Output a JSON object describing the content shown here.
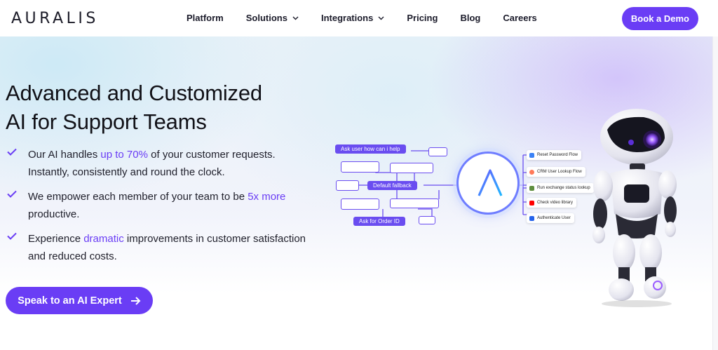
{
  "header": {
    "logo": "AURALIS",
    "nav": [
      {
        "label": "Platform",
        "dropdown": false
      },
      {
        "label": "Solutions",
        "dropdown": true
      },
      {
        "label": "Integrations",
        "dropdown": true
      },
      {
        "label": "Pricing",
        "dropdown": false
      },
      {
        "label": "Blog",
        "dropdown": false
      },
      {
        "label": "Careers",
        "dropdown": false
      }
    ],
    "cta": "Book a Demo"
  },
  "hero": {
    "title_line1": "Advanced and Customized",
    "title_line2": "AI for Support Teams",
    "bullets": [
      {
        "before": "Our AI handles ",
        "highlight": "up to 70%",
        "after": " of your customer requests. Instantly, consistently and round the clock."
      },
      {
        "before": "We empower each member of your team to be ",
        "highlight": "5x more",
        "after": " productive."
      },
      {
        "before": "Experience ",
        "highlight": "dramatic",
        "after": " improvements in customer satisfaction and reduced costs."
      }
    ],
    "cta": "Speak to an AI Expert"
  },
  "diagram": {
    "pills": [
      "Ask user how can i help",
      "Default fallback",
      "Ask for Order ID"
    ],
    "tools": [
      {
        "label": "Reset Password Flow",
        "icon": "shield-icon",
        "color": "#3b82f6"
      },
      {
        "label": "CRM User Lookup Flow",
        "icon": "hubspot-icon",
        "color": "#ff7a59"
      },
      {
        "label": "Run exchange status lookup",
        "icon": "shopify-icon",
        "color": "#5e8e3e"
      },
      {
        "label": "Check video library",
        "icon": "youtube-icon",
        "color": "#ff0000"
      },
      {
        "label": "Authenticate User",
        "icon": "shield-icon",
        "color": "#2563eb"
      }
    ]
  },
  "colors": {
    "accent": "#6a3df5"
  }
}
